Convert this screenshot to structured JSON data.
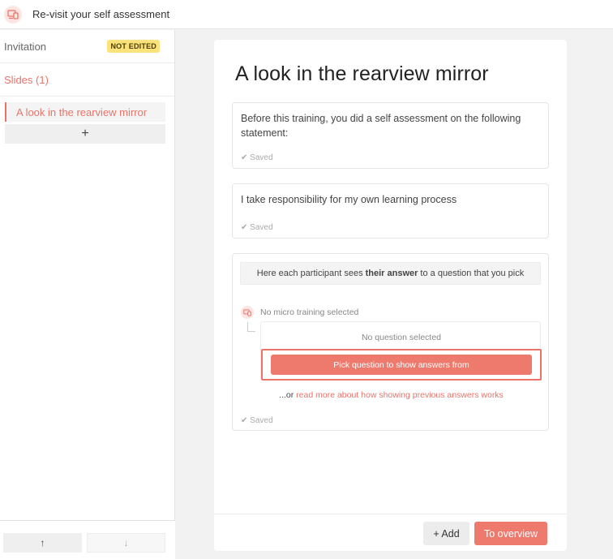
{
  "topbar": {
    "title": "Re-visit your self assessment",
    "icon": "devices-icon"
  },
  "sidebar": {
    "invitation_label": "Invitation",
    "invitation_badge": "NOT EDITED",
    "slides_label": "Slides (1)",
    "slides": [
      {
        "label": "A look in the rearview mirror"
      }
    ],
    "add_label": "+",
    "move_up": "↑",
    "move_down": "↓"
  },
  "slide": {
    "title": "A look in the rearview mirror",
    "blocks": [
      {
        "text": "Before this training, you did a self assessment on the following statement:",
        "status": "✔ Saved"
      },
      {
        "text": "I take responsibility for my own learning process",
        "status": "✔ Saved"
      }
    ],
    "answers_block": {
      "hint_before": "Here each participant sees",
      "hint_bold": "their answer",
      "hint_after": "to a question that you pick",
      "micro_training": "No micro training selected",
      "no_question": "No question selected",
      "pick_button": "Pick question to show answers from",
      "read_more_prefix": "...or",
      "read_more_link": "read more about how showing previous answers works",
      "status": "✔ Saved"
    }
  },
  "footer": {
    "add_label": "+ Add",
    "overview_label": "To overview"
  },
  "colors": {
    "accent": "#ee7a6e",
    "badge": "#fbe27a"
  }
}
